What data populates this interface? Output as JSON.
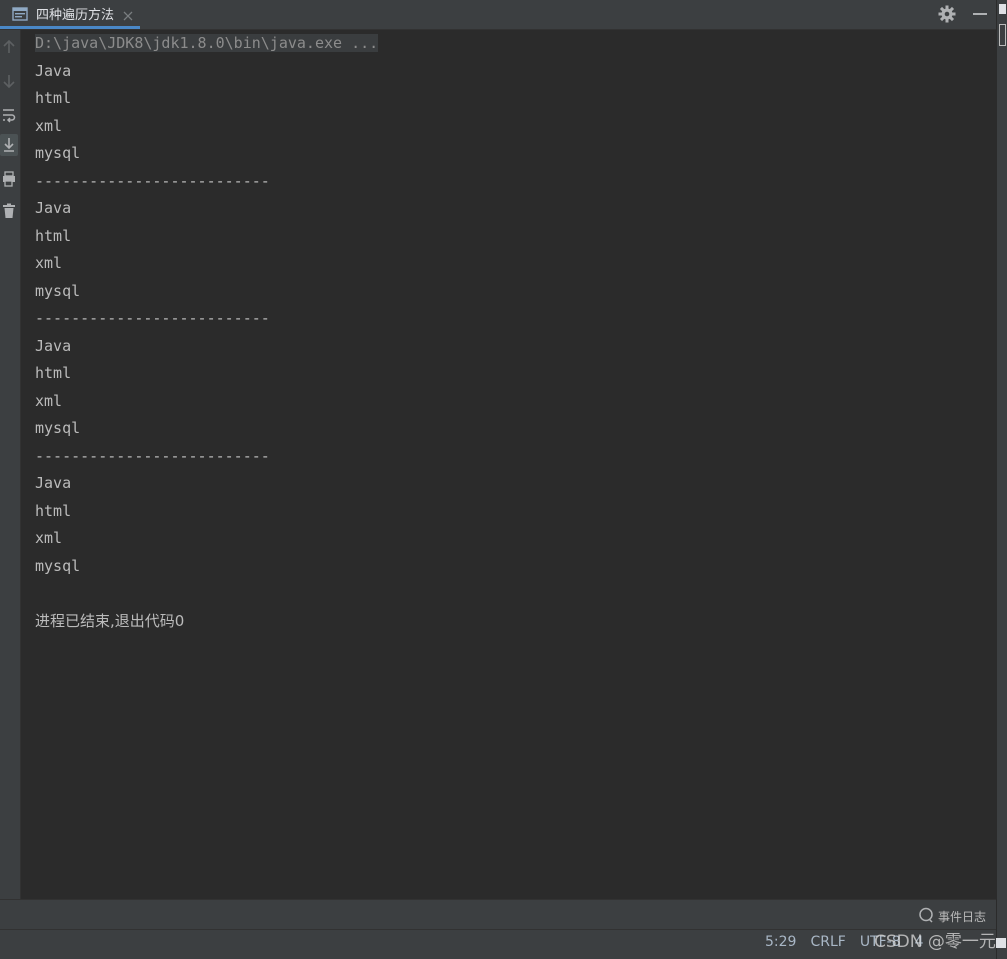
{
  "tab": {
    "label": "四种遍历方法"
  },
  "console": {
    "command": "D:\\java\\JDK8\\jdk1.8.0\\bin\\java.exe ...",
    "lines": [
      "Java",
      "html",
      "xml",
      "mysql",
      "--------------------------",
      "Java",
      "html",
      "xml",
      "mysql",
      "--------------------------",
      "Java",
      "html",
      "xml",
      "mysql",
      "--------------------------",
      "Java",
      "html",
      "xml",
      "mysql",
      "",
      "进程已结束,退出代码0"
    ]
  },
  "event_log": {
    "label": "事件日志"
  },
  "status": {
    "position": "5:29",
    "line_ending": "CRLF",
    "encoding": "UTF-8",
    "indent": "4"
  },
  "watermark": "CSDN @零一元",
  "icons": {
    "tab": "console-window-icon",
    "tab_close": "close-icon",
    "settings": "gear-icon",
    "minimize": "minimize-icon",
    "gutter": [
      "arrow-up-icon",
      "arrow-down-icon",
      "soft-wrap-icon",
      "scroll-to-end-icon",
      "print-icon",
      "trash-icon"
    ],
    "event_log": "event-log-icon"
  },
  "colors": {
    "background": "#2b2b2b",
    "panel": "#3c3f41",
    "text": "#bbbbbb",
    "command_text": "#8c8c8c",
    "tab_underline": "#4a88c7"
  }
}
